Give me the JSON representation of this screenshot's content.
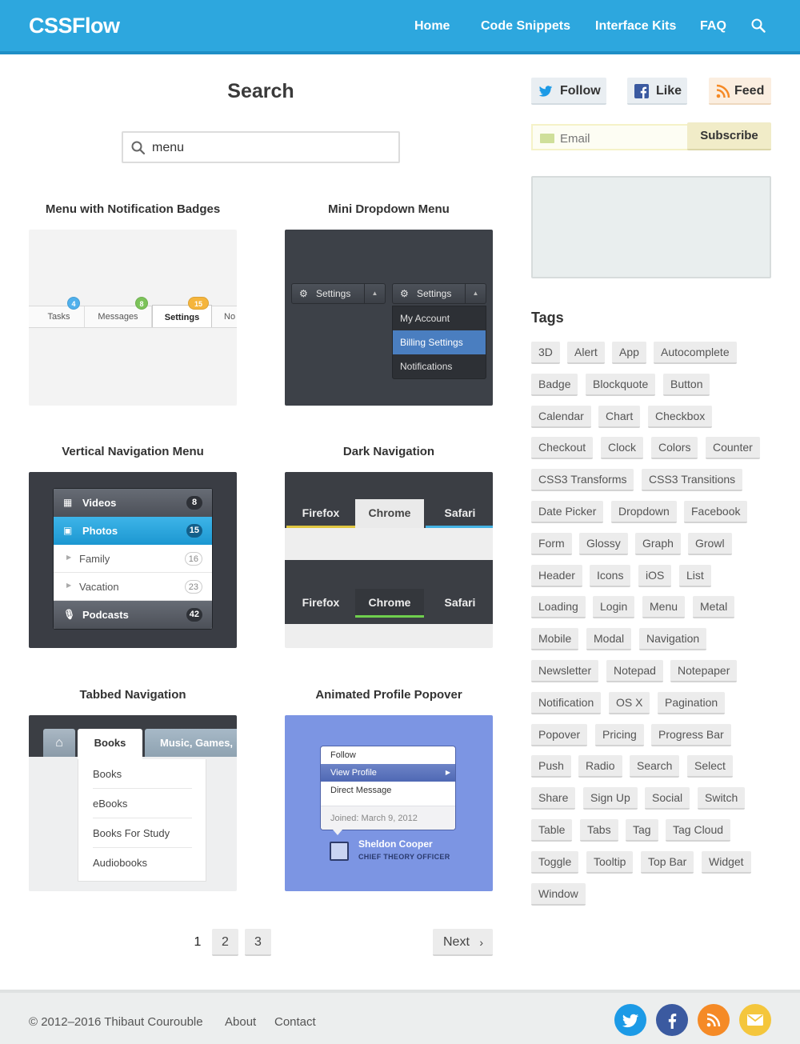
{
  "header": {
    "logo": "CSSFlow",
    "nav": [
      "Home",
      "Code Snippets",
      "Interface Kits",
      "FAQ"
    ],
    "brand_color": "#2da7de"
  },
  "search": {
    "title": "Search",
    "query": "menu"
  },
  "cards": [
    {
      "title": "Menu with Notification Badges",
      "tabs": [
        "Tasks",
        "Messages",
        "Settings",
        "No"
      ],
      "badges": [
        "4",
        "8",
        "15"
      ]
    },
    {
      "title": "Mini Dropdown Menu",
      "button1": "Settings",
      "button2": "Settings",
      "menu": [
        "My Account",
        "Billing Settings",
        "Notifications"
      ]
    },
    {
      "title": "Vertical Navigation Menu",
      "items": [
        {
          "label": "Videos",
          "count": "8"
        },
        {
          "label": "Photos",
          "count": "15"
        },
        {
          "label": "Family",
          "count": "16"
        },
        {
          "label": "Vacation",
          "count": "23"
        },
        {
          "label": "Podcasts",
          "count": "42"
        }
      ]
    },
    {
      "title": "Dark Navigation",
      "tabs1": [
        "Firefox",
        "Chrome",
        "Safari"
      ],
      "tabs2": [
        "Firefox",
        "Chrome",
        "Safari"
      ]
    },
    {
      "title": "Tabbed Navigation",
      "active_tab": "Books",
      "other_tab": "Music, Games,",
      "list": [
        "Books",
        "eBooks",
        "Books For Study",
        "Audiobooks"
      ]
    },
    {
      "title": "Animated Profile Popover",
      "menu": [
        "Follow",
        "View Profile",
        "Direct Message"
      ],
      "joined": "Joined: March 9, 2012",
      "name": "Sheldon Cooper",
      "role": "CHIEF THEORY OFFICER"
    }
  ],
  "pagination": {
    "pages": [
      "1",
      "2",
      "3"
    ],
    "current": "1",
    "next": "Next"
  },
  "sidebar": {
    "follow": "Follow",
    "like": "Like",
    "feed": "Feed",
    "email_placeholder": "Email",
    "subscribe": "Subscribe",
    "tags_title": "Tags",
    "tags": [
      "3D",
      "Alert",
      "App",
      "Autocomplete",
      "Badge",
      "Blockquote",
      "Button",
      "Calendar",
      "Chart",
      "Checkbox",
      "Checkout",
      "Clock",
      "Colors",
      "Counter",
      "CSS3 Transforms",
      "CSS3 Transitions",
      "Date Picker",
      "Dropdown",
      "Facebook",
      "Form",
      "Glossy",
      "Graph",
      "Growl",
      "Header",
      "Icons",
      "iOS",
      "List",
      "Loading",
      "Login",
      "Menu",
      "Metal",
      "Mobile",
      "Modal",
      "Navigation",
      "Newsletter",
      "Notepad",
      "Notepaper",
      "Notification",
      "OS X",
      "Pagination",
      "Popover",
      "Pricing",
      "Progress Bar",
      "Push",
      "Radio",
      "Search",
      "Select",
      "Share",
      "Sign Up",
      "Social",
      "Switch",
      "Table",
      "Tabs",
      "Tag",
      "Tag Cloud",
      "Toggle",
      "Tooltip",
      "Top Bar",
      "Widget",
      "Window"
    ]
  },
  "footer": {
    "copyright": "© 2012–2016 Thibaut Courouble",
    "about": "About",
    "contact": "Contact",
    "social_colors": [
      "#1c9ae6",
      "#3b5aa0",
      "#f58a26",
      "#f4c63c"
    ]
  }
}
